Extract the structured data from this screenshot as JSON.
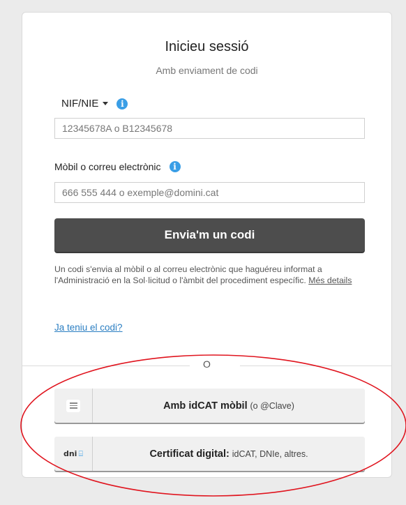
{
  "login": {
    "title": "Inicieu sessió",
    "subtitle": "Amb enviament de codi",
    "nif_label": "NIF/NIE",
    "nif_placeholder": "12345678A o B12345678",
    "mobil_label": "Mòbil o correu electrònic",
    "mobil_placeholder": "666 555 444 o exemple@domini.cat",
    "send_button": "Envia'm un codi",
    "info_text": "Un codi s'envia al mòbil o al correu electrònic que haguéreu informat a l'Administració en la Sol·licitud o l'àmbit del procediment específic.",
    "more_details": "Més details",
    "have_code_link": "Ja teniu el codi?",
    "divider": "O",
    "info_icon": "i"
  },
  "methods": {
    "idcat_label": "Amb idCAT mòbil",
    "idcat_sub": "(o @Clave)",
    "cert_label": "Certificat digital:",
    "cert_sub": "idCAT, DNIe, altres.",
    "cert_icon_text": "dni"
  },
  "icons": {
    "chat": "chat-bubble-icon",
    "dni": "dni-card-icon",
    "info": "info-icon"
  },
  "colors": {
    "accent": "#3a9ee6",
    "button_dark": "#4d4d4d",
    "link": "#2a7ec2",
    "annotation": "#e0141e"
  }
}
